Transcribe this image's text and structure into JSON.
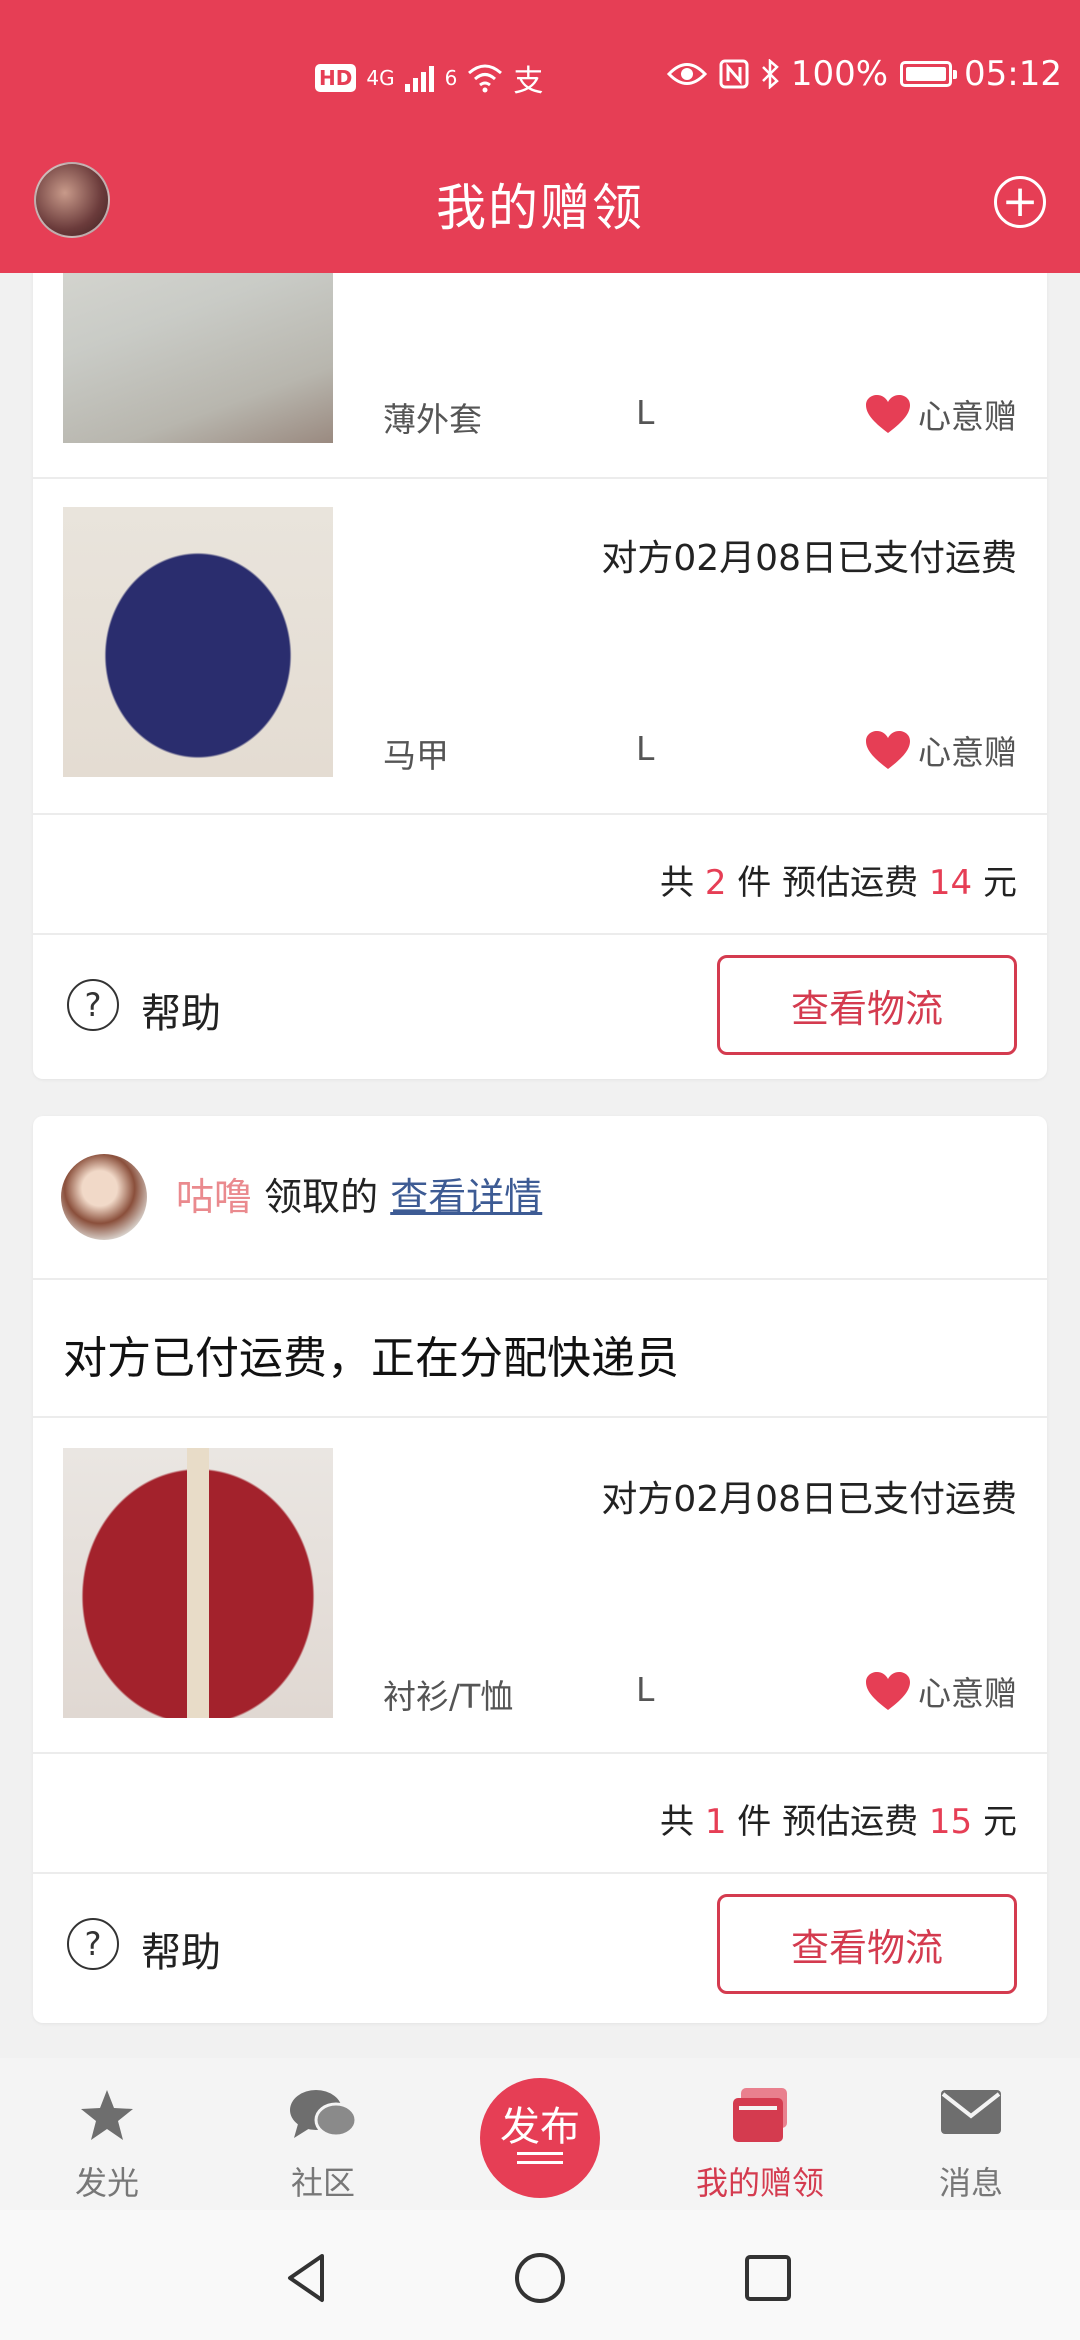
{
  "status_bar": {
    "hd": "HD",
    "network": "4G",
    "wifi_tag": "6",
    "battery": "100%",
    "time": "05:12"
  },
  "header": {
    "title": "我的赠领"
  },
  "card1": {
    "items": [
      {
        "category": "薄外套",
        "size": "L",
        "gift_tag": "心意赠"
      },
      {
        "payment": "对方02月08日已支付运费",
        "category": "马甲",
        "size": "L",
        "gift_tag": "心意赠"
      }
    ],
    "total": {
      "prefix": "共",
      "count": "2",
      "mid": "件 预估运费",
      "fee": "14",
      "suffix": "元"
    },
    "help_label": "帮助",
    "logistics_label": "查看物流"
  },
  "card2": {
    "username": "咕噜",
    "claim_text": "领取的",
    "detail_link": "查看详情",
    "status": "对方已付运费，正在分配快递员",
    "item": {
      "payment": "对方02月08日已支付运费",
      "category": "衬衫/T恤",
      "size": "L",
      "gift_tag": "心意赠"
    },
    "total": {
      "prefix": "共",
      "count": "1",
      "mid": "件 预估运费",
      "fee": "15",
      "suffix": "元"
    },
    "help_label": "帮助",
    "logistics_label": "查看物流"
  },
  "tabbar": {
    "tabs": [
      {
        "label": "发光",
        "icon": "star-icon"
      },
      {
        "label": "社区",
        "icon": "chat-bubbles-icon"
      },
      {
        "label": "发布",
        "icon": "publish-icon"
      },
      {
        "label": "我的赠领",
        "icon": "gift-cards-icon"
      },
      {
        "label": "消息",
        "icon": "mail-icon"
      }
    ]
  },
  "colors": {
    "brand": "#e63e55",
    "accent_text": "#d43b4f",
    "username": "#ea8a8e",
    "link": "#3d5b94"
  }
}
